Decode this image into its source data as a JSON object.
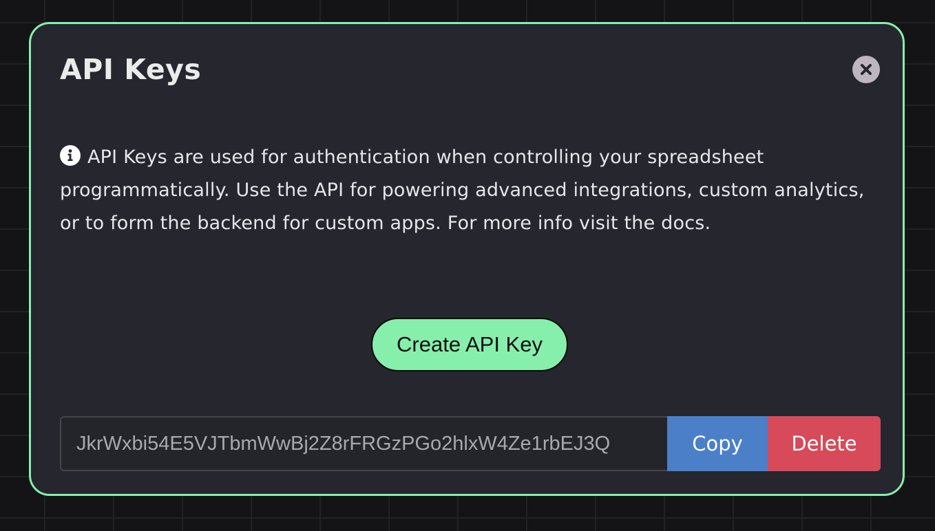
{
  "modal": {
    "title": "API Keys",
    "close_icon": "close-x-icon",
    "info_icon": "info-circle-icon",
    "info_text": "API Keys are used for authentication when controlling your spreadsheet programmatically. Use the API for powering advanced integrations, custom analytics, or to form the backend for custom apps. For more info visit the docs.",
    "create_label": "Create API Key",
    "api_key_value": "JkrWxbi54E5VJTbmWwBj2Z8rFRGzPGo2hlxW4Ze1rbEJ3Q",
    "copy_label": "Copy",
    "delete_label": "Delete"
  },
  "colors": {
    "background": "#141416",
    "modal_bg": "#26262f",
    "accent": "#86efac",
    "copy": "#4b7fc8",
    "delete": "#d64a5a"
  }
}
